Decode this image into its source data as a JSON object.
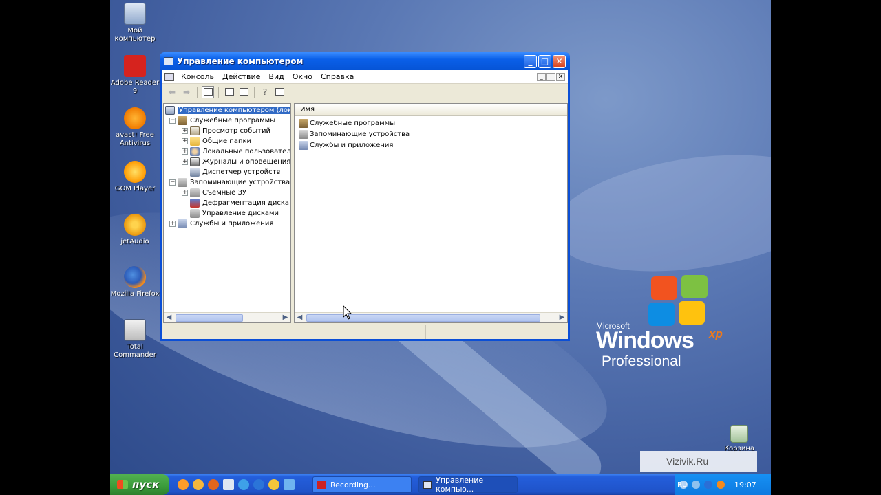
{
  "desktop": {
    "icons": [
      {
        "label": "Мой компьютер",
        "icon": "my-computer-icon"
      },
      {
        "label": "Adobe Reader 9",
        "icon": "adobe-reader-icon"
      },
      {
        "label": "avast! Free Antivirus",
        "icon": "avast-icon"
      },
      {
        "label": "GOM Player",
        "icon": "gom-player-icon"
      },
      {
        "label": "jetAudio",
        "icon": "jetaudio-icon"
      },
      {
        "label": "Mozilla Firefox",
        "icon": "firefox-icon"
      },
      {
        "label": "Total Commander",
        "icon": "total-commander-icon"
      }
    ],
    "recycle_label": "Корзина",
    "logo": {
      "microsoft": "Microsoft",
      "windows": "Windows",
      "xp": "xp",
      "edition": "Professional"
    },
    "watermark": "Vizivik.Ru"
  },
  "window": {
    "title": "Управление компьютером",
    "menu": [
      "Консоль",
      "Действие",
      "Вид",
      "Окно",
      "Справка"
    ],
    "tree": {
      "root": "Управление компьютером (локал",
      "groups": [
        {
          "label": "Служебные программы",
          "expander": "−",
          "icon": "tools-icon",
          "children": [
            {
              "label": "Просмотр событий",
              "expander": "+",
              "icon": "event-viewer-icon"
            },
            {
              "label": "Общие папки",
              "expander": "+",
              "icon": "shared-folders-icon"
            },
            {
              "label": "Локальные пользовател",
              "expander": "+",
              "icon": "local-users-icon"
            },
            {
              "label": "Журналы и оповещения пр",
              "expander": "+",
              "icon": "logs-alerts-icon"
            },
            {
              "label": "Диспетчер устройств",
              "expander": "",
              "icon": "device-manager-icon"
            }
          ]
        },
        {
          "label": "Запоминающие устройства",
          "expander": "−",
          "icon": "storage-icon",
          "children": [
            {
              "label": "Съемные ЗУ",
              "expander": "+",
              "icon": "removable-storage-icon"
            },
            {
              "label": "Дефрагментация диска",
              "expander": "",
              "icon": "defrag-icon"
            },
            {
              "label": "Управление дисками",
              "expander": "",
              "icon": "disk-management-icon"
            }
          ]
        },
        {
          "label": "Службы и приложения",
          "expander": "+",
          "icon": "services-icon",
          "children": []
        }
      ]
    },
    "list": {
      "header": "Имя",
      "items": [
        "Служебные программы",
        "Запоминающие устройства",
        "Службы и приложения"
      ]
    }
  },
  "taskbar": {
    "start_label": "пуск",
    "tasks": [
      {
        "label": "Recording...",
        "icon": "record-icon",
        "active": false
      },
      {
        "label": "Управление компью...",
        "icon": "computer-management-icon",
        "active": true
      }
    ],
    "lang": "RU",
    "clock": "19:07"
  }
}
